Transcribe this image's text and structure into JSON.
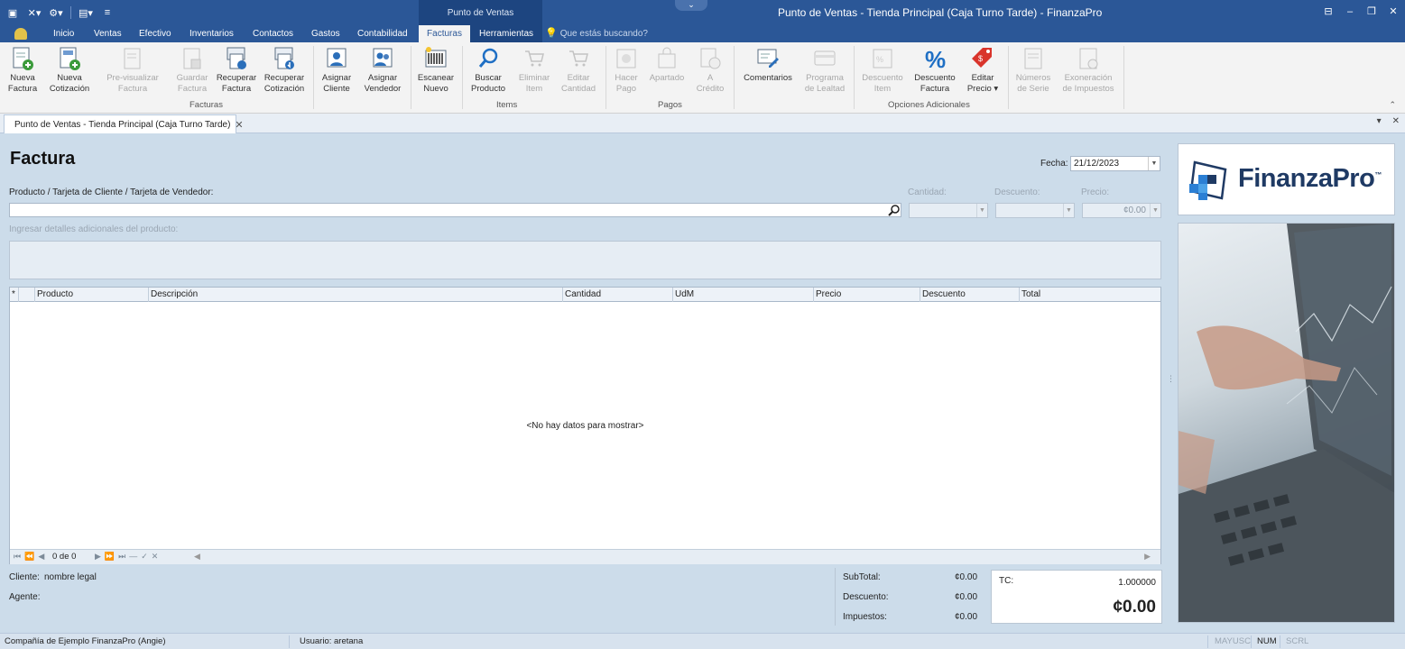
{
  "window": {
    "title": "Punto de Ventas - Tienda Principal (Caja Turno Tarde) - FinanzaPro",
    "context_group": "Punto de Ventas"
  },
  "tabs": [
    {
      "label": "Inicio"
    },
    {
      "label": "Ventas"
    },
    {
      "label": "Efectivo"
    },
    {
      "label": "Inventarios"
    },
    {
      "label": "Contactos"
    },
    {
      "label": "Gastos"
    },
    {
      "label": "Contabilidad"
    },
    {
      "label": "Facturas",
      "active": true
    },
    {
      "label": "Herramientas"
    }
  ],
  "tell_me": "Que estás buscando?",
  "ribbon": {
    "buttons": {
      "nueva_factura": [
        "Nueva",
        "Factura"
      ],
      "nueva_cotizacion": [
        "Nueva",
        "Cotización"
      ],
      "previsualizar": [
        "Pre-visualizar",
        "Factura"
      ],
      "guardar_factura": [
        "Guardar",
        "Factura"
      ],
      "recuperar_factura": [
        "Recuperar",
        "Factura"
      ],
      "recuperar_cotizacion": [
        "Recuperar",
        "Cotización"
      ],
      "asignar_cliente": [
        "Asignar",
        "Cliente"
      ],
      "asignar_vendedor": [
        "Asignar",
        "Vendedor"
      ],
      "escanear_nuevo": [
        "Escanear",
        "Nuevo"
      ],
      "buscar_producto": [
        "Buscar",
        "Producto"
      ],
      "eliminar_item": [
        "Eliminar",
        "Item"
      ],
      "editar_cantidad": [
        "Editar",
        "Cantidad"
      ],
      "hacer_pago": [
        "Hacer",
        "Pago"
      ],
      "apartado": [
        "Apartado",
        ""
      ],
      "a_credito": [
        "A",
        "Crédito"
      ],
      "comentarios": [
        "Comentarios",
        ""
      ],
      "programa_lealtad": [
        "Programa",
        "de Lealtad"
      ],
      "descuento_item": [
        "Descuento",
        "Item"
      ],
      "descuento_factura": [
        "Descuento",
        "Factura"
      ],
      "editar_precio": [
        "Editar",
        "Precio ▾"
      ],
      "numeros_serie": [
        "Números",
        "de Serie"
      ],
      "exoneracion": [
        "Exoneración",
        "de Impuestos"
      ]
    },
    "groups": {
      "facturas": "Facturas",
      "items": "Items",
      "pagos": "Pagos",
      "opciones": "Opciones Adicionales"
    }
  },
  "document_tab": "Punto de Ventas - Tienda Principal (Caja Turno Tarde)",
  "form": {
    "title": "Factura",
    "fecha_label": "Fecha:",
    "fecha_value": "21/12/2023",
    "product_label": "Producto / Tarjeta de Cliente / Tarjeta de Vendedor:",
    "cantidad_label": "Cantidad:",
    "descuento_label": "Descuento:",
    "precio_label": "Precio:",
    "precio_value": "¢0.00",
    "detail_label": "Ingresar detalles adicionales del producto:"
  },
  "grid": {
    "columns": [
      "*",
      "",
      "Producto",
      "Descripción",
      "Cantidad",
      "UdM",
      "Precio",
      "Descuento",
      "Total"
    ],
    "empty": "<No hay datos para mostrar>",
    "pager": "0 de 0"
  },
  "footer": {
    "cliente_label": "Cliente:",
    "cliente_value": "nombre legal",
    "agente_label": "Agente:",
    "subtotal_label": "SubTotal:",
    "subtotal_value": "¢0.00",
    "descuento_label": "Descuento:",
    "descuento_value": "¢0.00",
    "impuestos_label": "Impuestos:",
    "impuestos_value": "¢0.00",
    "tc_label": "TC:",
    "tc_value": "1.000000",
    "total": "¢0.00"
  },
  "brand": {
    "name": "FinanzaPro",
    "tm": "™"
  },
  "status": {
    "company": "Compañía de Ejemplo FinanzaPro (Angie)",
    "user": "Usuario: aretana",
    "mayusc": "MAYUSC",
    "num": "NUM",
    "scrl": "SCRL"
  },
  "colors": {
    "title_bar": "#2b5797",
    "context_tab": "#1d4580",
    "panel_bg": "#ccdcea",
    "accent": "#1f6fc4",
    "tag_red": "#d9342b"
  }
}
